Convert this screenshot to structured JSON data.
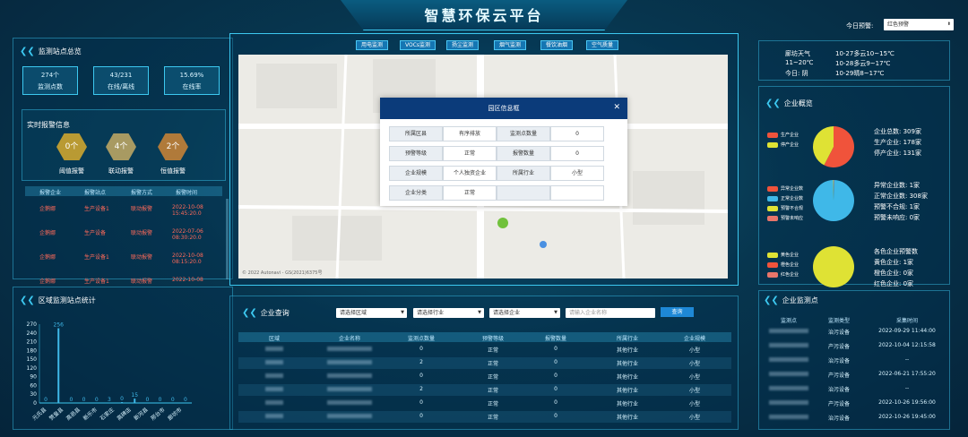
{
  "header": {
    "title": "智慧环保云平台",
    "today_warning_label": "今日预警:",
    "today_warning_value": "红色预警"
  },
  "left": {
    "overview": {
      "title": "监测站点总览",
      "stats": [
        {
          "value": "274个",
          "label": "监测点数"
        },
        {
          "value": "43/231",
          "label": "在线/离线"
        },
        {
          "value": "15.69%",
          "label": "在线率"
        }
      ]
    },
    "alarm": {
      "title": "实时报警信息",
      "badges": [
        {
          "value": "0个",
          "label": "阈值报警",
          "color": "#b99a33"
        },
        {
          "value": "4个",
          "label": "联动报警",
          "color": "#a89a62"
        },
        {
          "value": "2个",
          "label": "恒值报警",
          "color": "#b07a3a"
        }
      ],
      "columns": [
        "报警企业",
        "报警站点",
        "报警方式",
        "报警时间"
      ],
      "rows": [
        {
          "company": "企鹅娜",
          "site": "生产设备1",
          "method": "联动报警",
          "time1": "2022-10-08",
          "time2": "15:45:20.0"
        },
        {
          "company": "企鹅娜",
          "site": "生产设备",
          "method": "联动报警",
          "time1": "2022-07-06",
          "time2": "08:30:20.0"
        },
        {
          "company": "企鹅娜",
          "site": "生产设备1",
          "method": "联动报警",
          "time1": "2022-10-08",
          "time2": "08:15:20.0"
        },
        {
          "company": "企鹅娜",
          "site": "生产设备1",
          "method": "联动报警",
          "time1": "2022-10-08",
          "time2": ""
        }
      ]
    },
    "region_chart": {
      "title": "区域监测站点统计"
    }
  },
  "chart_data": {
    "type": "bar",
    "categories": [
      "元氏县",
      "赞皇县",
      "高邑县",
      "新乐市",
      "石家庄",
      "高碑店",
      "新河县",
      "邢台市",
      "廊坊市",
      "",
      "",
      ""
    ],
    "x_tick_labels": [
      "元氏县",
      "赞皇县",
      "高邑县",
      "新乐市",
      "石家庄",
      "高碑店",
      "新河县",
      "邢台市",
      "廊坊市"
    ],
    "values": [
      0,
      256,
      0,
      0,
      0,
      0,
      3,
      15,
      0,
      0,
      0,
      0
    ],
    "value_labels": [
      "0",
      "256",
      "0",
      "0",
      "0",
      "3",
      "0",
      "15",
      "0",
      "0",
      "0",
      "0"
    ],
    "yticks": [
      0,
      30,
      60,
      90,
      120,
      150,
      180,
      210,
      240,
      270
    ],
    "ylim": [
      0,
      270
    ],
    "color": "#3fb8e8"
  },
  "center": {
    "tabs": [
      "用电监测",
      "VOCs监测",
      "扬尘监测",
      "烟气监测",
      "餐饮油烟",
      "空气质量"
    ],
    "map_copyright": "© 2022 Autonavi - GS(2021)6375号",
    "modal": {
      "title": "园区信息框",
      "rows": [
        [
          {
            "k": "所属区县"
          },
          {
            "v": "有序排放"
          },
          {
            "k": "监测点数量"
          },
          {
            "v": "0"
          }
        ],
        [
          {
            "k": "预警等级"
          },
          {
            "v": "正常"
          },
          {
            "k": "报警数量"
          },
          {
            "v": "0"
          }
        ],
        [
          {
            "k": "企业规模"
          },
          {
            "v": "个人独资企业"
          },
          {
            "k": "所属行业"
          },
          {
            "v": "小型"
          }
        ],
        [
          {
            "k": "企业分类"
          },
          {
            "v": "正常"
          },
          {
            "k": ""
          },
          {
            "v": ""
          }
        ]
      ]
    },
    "query": {
      "title": "企业查询",
      "selects": [
        "请选择区域",
        "请选择行业",
        "请选择企业"
      ],
      "search_placeholder": "请输入企业名称",
      "search_button": "查询",
      "columns": [
        "区域",
        "企业名称",
        "监测点数量",
        "预警等级",
        "报警数量",
        "所属行业",
        "企业规模"
      ],
      "rows": [
        {
          "count": "0",
          "level": "正常",
          "alarms": "0",
          "industry": "其他行业",
          "size": "小型"
        },
        {
          "count": "2",
          "level": "正常",
          "alarms": "0",
          "industry": "其他行业",
          "size": "小型"
        },
        {
          "count": "0",
          "level": "正常",
          "alarms": "0",
          "industry": "其他行业",
          "size": "小型"
        },
        {
          "count": "2",
          "level": "正常",
          "alarms": "0",
          "industry": "其他行业",
          "size": "小型"
        },
        {
          "count": "0",
          "level": "正常",
          "alarms": "0",
          "industry": "其他行业",
          "size": "小型"
        },
        {
          "count": "0",
          "level": "正常",
          "alarms": "0",
          "industry": "其他行业",
          "size": "小型"
        }
      ]
    }
  },
  "right": {
    "weather": [
      {
        "day": "廊坊天气",
        "desc": "10-27多云10~15℃"
      },
      {
        "day": "11~20℃",
        "desc": "10-28多云9~17℃"
      },
      {
        "day": "今日:  阴",
        "desc": "10-29晴8~17℃"
      }
    ],
    "enterprise": {
      "title": "企业概览",
      "pie1": {
        "legend": [
          "生产企业",
          "停产企业"
        ],
        "colors": [
          "#f0533b",
          "#dfe234"
        ],
        "stats": [
          "企业总数:  309家",
          "生产企业:  178家",
          "停产企业:  131家"
        ],
        "values": [
          178,
          131
        ]
      },
      "pie2": {
        "legend": [
          "异常企业数",
          "正常企业数",
          "预警不合规",
          "预警未响应"
        ],
        "colors": [
          "#f0533b",
          "#3fb8e8",
          "#dfe234",
          "#e8756a"
        ],
        "stats": [
          "异常企业数:  1家",
          "正常企业数:  308家",
          "预警不合规:  1家",
          "预警未响应:  0家"
        ],
        "values": [
          1,
          308,
          1,
          0
        ]
      },
      "pie3": {
        "legend": [
          "黄色企业",
          "橙色企业",
          "红色企业"
        ],
        "colors": [
          "#dfe234",
          "#f0533b",
          "#e8756a"
        ],
        "stats": [
          "各色企业预警数",
          "黄色企业:  1家",
          "橙色企业:  0家",
          "红色企业:  0家"
        ],
        "values": [
          1,
          0,
          0
        ]
      }
    },
    "monitor": {
      "title": "企业监测点",
      "columns": [
        "监测点",
        "监测类型",
        "采集时间"
      ],
      "rows": [
        {
          "type": "治污设备",
          "time": "2022-09-29 11:44:00"
        },
        {
          "type": "产污设备",
          "time": "2022-10-04 12:15:58"
        },
        {
          "type": "治污设备",
          "time": "--"
        },
        {
          "type": "产污设备",
          "time": "2022-06-21 17:55:20"
        },
        {
          "type": "治污设备",
          "time": "--"
        },
        {
          "type": "产污设备",
          "time": "2022-10-26 19:56:00"
        },
        {
          "type": "治污设备",
          "time": "2022-10-26 19:45:00"
        }
      ]
    }
  }
}
